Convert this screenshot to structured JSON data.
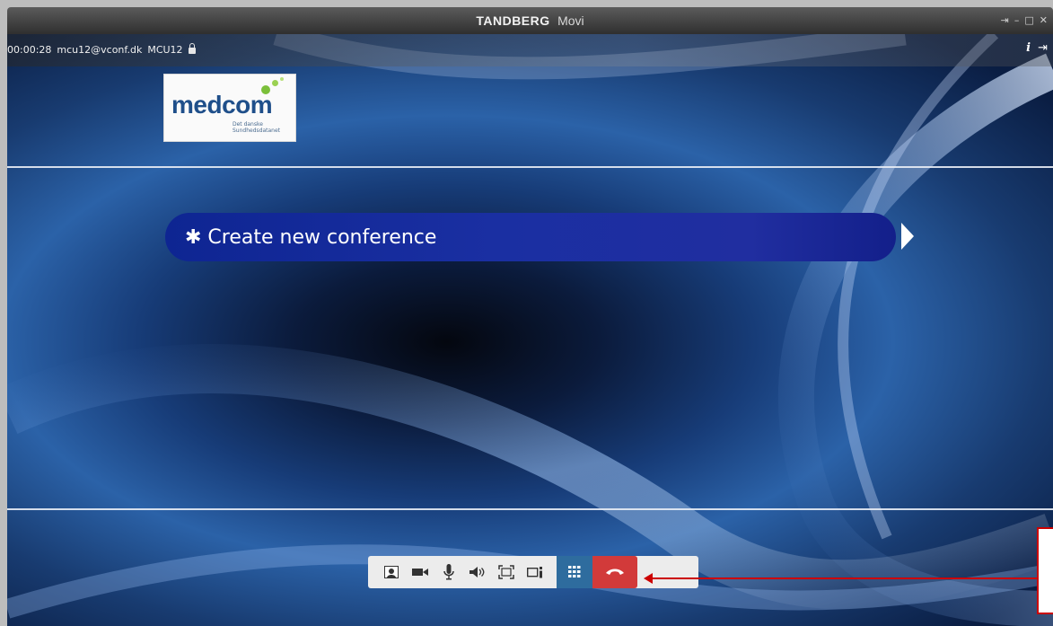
{
  "window": {
    "brand": "TANDBERG",
    "app": "Movi",
    "controls": [
      "⇥",
      "–",
      "□",
      "✕"
    ]
  },
  "infobar": {
    "timer": "00:00:28",
    "address": "mcu12@vconf.dk",
    "endpoint": "MCU12",
    "info_glyph": "i",
    "pin_glyph": "⇥"
  },
  "logo": {
    "word": "medcom",
    "subtitle": "Det danske\nSundhedsdatanet"
  },
  "conference": {
    "label": "✱ Create new conference"
  },
  "toolbar": {
    "buttons": [
      "self-view",
      "camera",
      "microphone",
      "speaker",
      "fullscreen",
      "layout",
      "keypad",
      "hang-up"
    ]
  },
  "colors": {
    "accent_active": "#2e6c9e",
    "hangup": "#d23a3a",
    "annotation": "#cc0000",
    "pill": "#1a2fa2"
  }
}
